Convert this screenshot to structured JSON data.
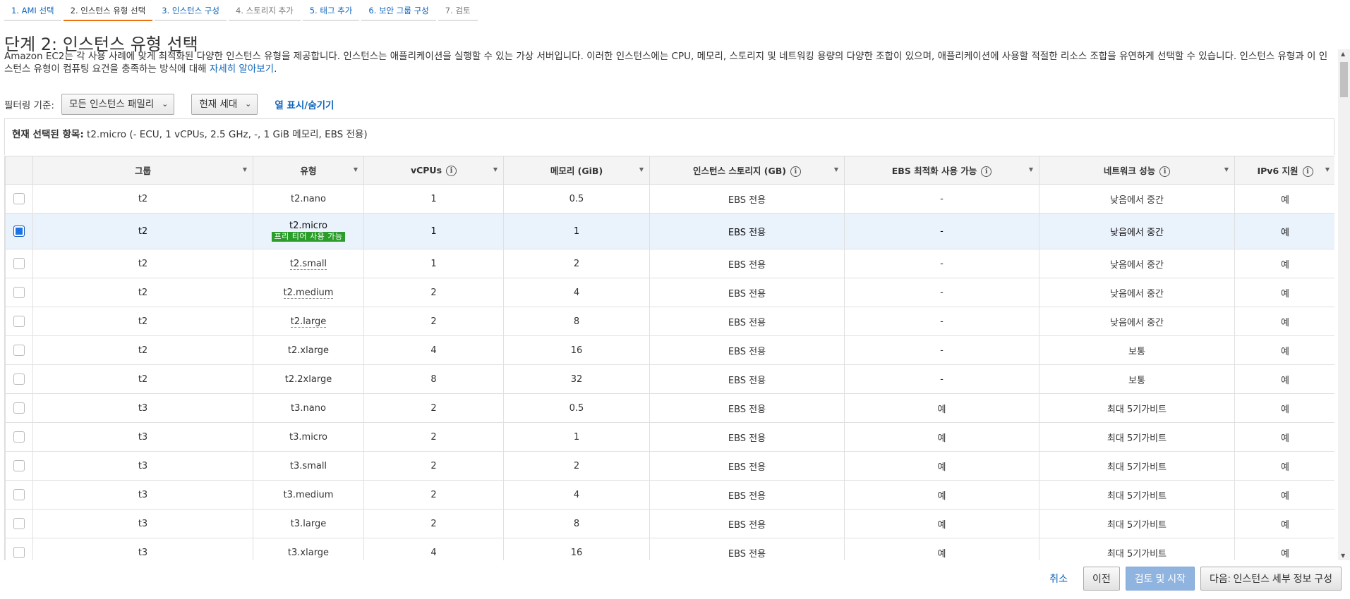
{
  "steps": [
    {
      "label": "1. AMI 선택",
      "state": "link"
    },
    {
      "label": "2. 인스턴스 유형 선택",
      "state": "active"
    },
    {
      "label": "3. 인스턴스 구성",
      "state": "link"
    },
    {
      "label": "4. 스토리지 추가",
      "state": "disabled"
    },
    {
      "label": "5. 태그 추가",
      "state": "link"
    },
    {
      "label": "6. 보안 그룹 구성",
      "state": "link"
    },
    {
      "label": "7. 검토",
      "state": "disabled"
    }
  ],
  "title": "단계 2: 인스턴스 유형 선택",
  "description": {
    "text": "Amazon EC2는 각 사용 사례에 맞게 최적화된 다양한 인스턴스 유형을 제공합니다. 인스턴스는 애플리케이션을 실행할 수 있는 가상 서버입니다. 이러한 인스턴스에는 CPU, 메모리, 스토리지 및 네트워킹 용량의 다양한 조합이 있으며, 애플리케이션에 사용할 적절한 리소스 조합을 유연하게 선택할 수 있습니다. 인스턴스 유형과 이 인스턴스 유형이 컴퓨팅 요건을 충족하는 방식에 대해 ",
    "link": "자세히 알아보기",
    "suffix": "."
  },
  "filter": {
    "label": "필터링 기준:",
    "family": "모든 인스턴스 패밀리",
    "generation": "현재 세대",
    "toggle_columns": "열 표시/숨기기"
  },
  "selected": {
    "label": "현재 선택된 항목:",
    "value": "t2.micro (- ECU, 1 vCPUs, 2.5 GHz, -, 1 GiB 메모리, EBS 전용)"
  },
  "columns": [
    {
      "label": "그룹",
      "info": false
    },
    {
      "label": "유형",
      "info": false
    },
    {
      "label": "vCPUs",
      "info": true
    },
    {
      "label": "메모리 (GiB)",
      "info": false
    },
    {
      "label": "인스턴스 스토리지 (GB)",
      "info": true
    },
    {
      "label": "EBS 최적화 사용 가능",
      "info": true
    },
    {
      "label": "네트워크 성능",
      "info": true
    },
    {
      "label": "IPv6 지원",
      "info": true
    }
  ],
  "free_tier_label": "프리 티어 사용 가능",
  "rows": [
    {
      "group": "t2",
      "type": "t2.nano",
      "vcpu": "1",
      "mem": "0.5",
      "storage": "EBS 전용",
      "ebs": "-",
      "net": "낮음에서 중간",
      "ipv6": "예",
      "checked": false,
      "free": false,
      "dotted": false
    },
    {
      "group": "t2",
      "type": "t2.micro",
      "vcpu": "1",
      "mem": "1",
      "storage": "EBS 전용",
      "ebs": "-",
      "net": "낮음에서 중간",
      "ipv6": "예",
      "checked": true,
      "free": true,
      "dotted": false
    },
    {
      "group": "t2",
      "type": "t2.small",
      "vcpu": "1",
      "mem": "2",
      "storage": "EBS 전용",
      "ebs": "-",
      "net": "낮음에서 중간",
      "ipv6": "예",
      "checked": false,
      "free": false,
      "dotted": true
    },
    {
      "group": "t2",
      "type": "t2.medium",
      "vcpu": "2",
      "mem": "4",
      "storage": "EBS 전용",
      "ebs": "-",
      "net": "낮음에서 중간",
      "ipv6": "예",
      "checked": false,
      "free": false,
      "dotted": true
    },
    {
      "group": "t2",
      "type": "t2.large",
      "vcpu": "2",
      "mem": "8",
      "storage": "EBS 전용",
      "ebs": "-",
      "net": "낮음에서 중간",
      "ipv6": "예",
      "checked": false,
      "free": false,
      "dotted": true
    },
    {
      "group": "t2",
      "type": "t2.xlarge",
      "vcpu": "4",
      "mem": "16",
      "storage": "EBS 전용",
      "ebs": "-",
      "net": "보통",
      "ipv6": "예",
      "checked": false,
      "free": false,
      "dotted": false
    },
    {
      "group": "t2",
      "type": "t2.2xlarge",
      "vcpu": "8",
      "mem": "32",
      "storage": "EBS 전용",
      "ebs": "-",
      "net": "보통",
      "ipv6": "예",
      "checked": false,
      "free": false,
      "dotted": false
    },
    {
      "group": "t3",
      "type": "t3.nano",
      "vcpu": "2",
      "mem": "0.5",
      "storage": "EBS 전용",
      "ebs": "예",
      "net": "최대 5기가비트",
      "ipv6": "예",
      "checked": false,
      "free": false,
      "dotted": false
    },
    {
      "group": "t3",
      "type": "t3.micro",
      "vcpu": "2",
      "mem": "1",
      "storage": "EBS 전용",
      "ebs": "예",
      "net": "최대 5기가비트",
      "ipv6": "예",
      "checked": false,
      "free": false,
      "dotted": false
    },
    {
      "group": "t3",
      "type": "t3.small",
      "vcpu": "2",
      "mem": "2",
      "storage": "EBS 전용",
      "ebs": "예",
      "net": "최대 5기가비트",
      "ipv6": "예",
      "checked": false,
      "free": false,
      "dotted": false
    },
    {
      "group": "t3",
      "type": "t3.medium",
      "vcpu": "2",
      "mem": "4",
      "storage": "EBS 전용",
      "ebs": "예",
      "net": "최대 5기가비트",
      "ipv6": "예",
      "checked": false,
      "free": false,
      "dotted": false
    },
    {
      "group": "t3",
      "type": "t3.large",
      "vcpu": "2",
      "mem": "8",
      "storage": "EBS 전용",
      "ebs": "예",
      "net": "최대 5기가비트",
      "ipv6": "예",
      "checked": false,
      "free": false,
      "dotted": false
    },
    {
      "group": "t3",
      "type": "t3.xlarge",
      "vcpu": "4",
      "mem": "16",
      "storage": "EBS 전용",
      "ebs": "예",
      "net": "최대 5기가비트",
      "ipv6": "예",
      "checked": false,
      "free": false,
      "dotted": false
    }
  ],
  "footer": {
    "cancel": "취소",
    "previous": "이전",
    "review_launch": "검토 및 시작",
    "next": "다음: 인스턴스 세부 정보 구성"
  },
  "colors": {
    "link": "#1166bb",
    "active_step": "#ec7211",
    "free_tier": "#2a9d2a",
    "selected_row": "#eaf2fc",
    "primary_button": "#8fb4e0"
  }
}
